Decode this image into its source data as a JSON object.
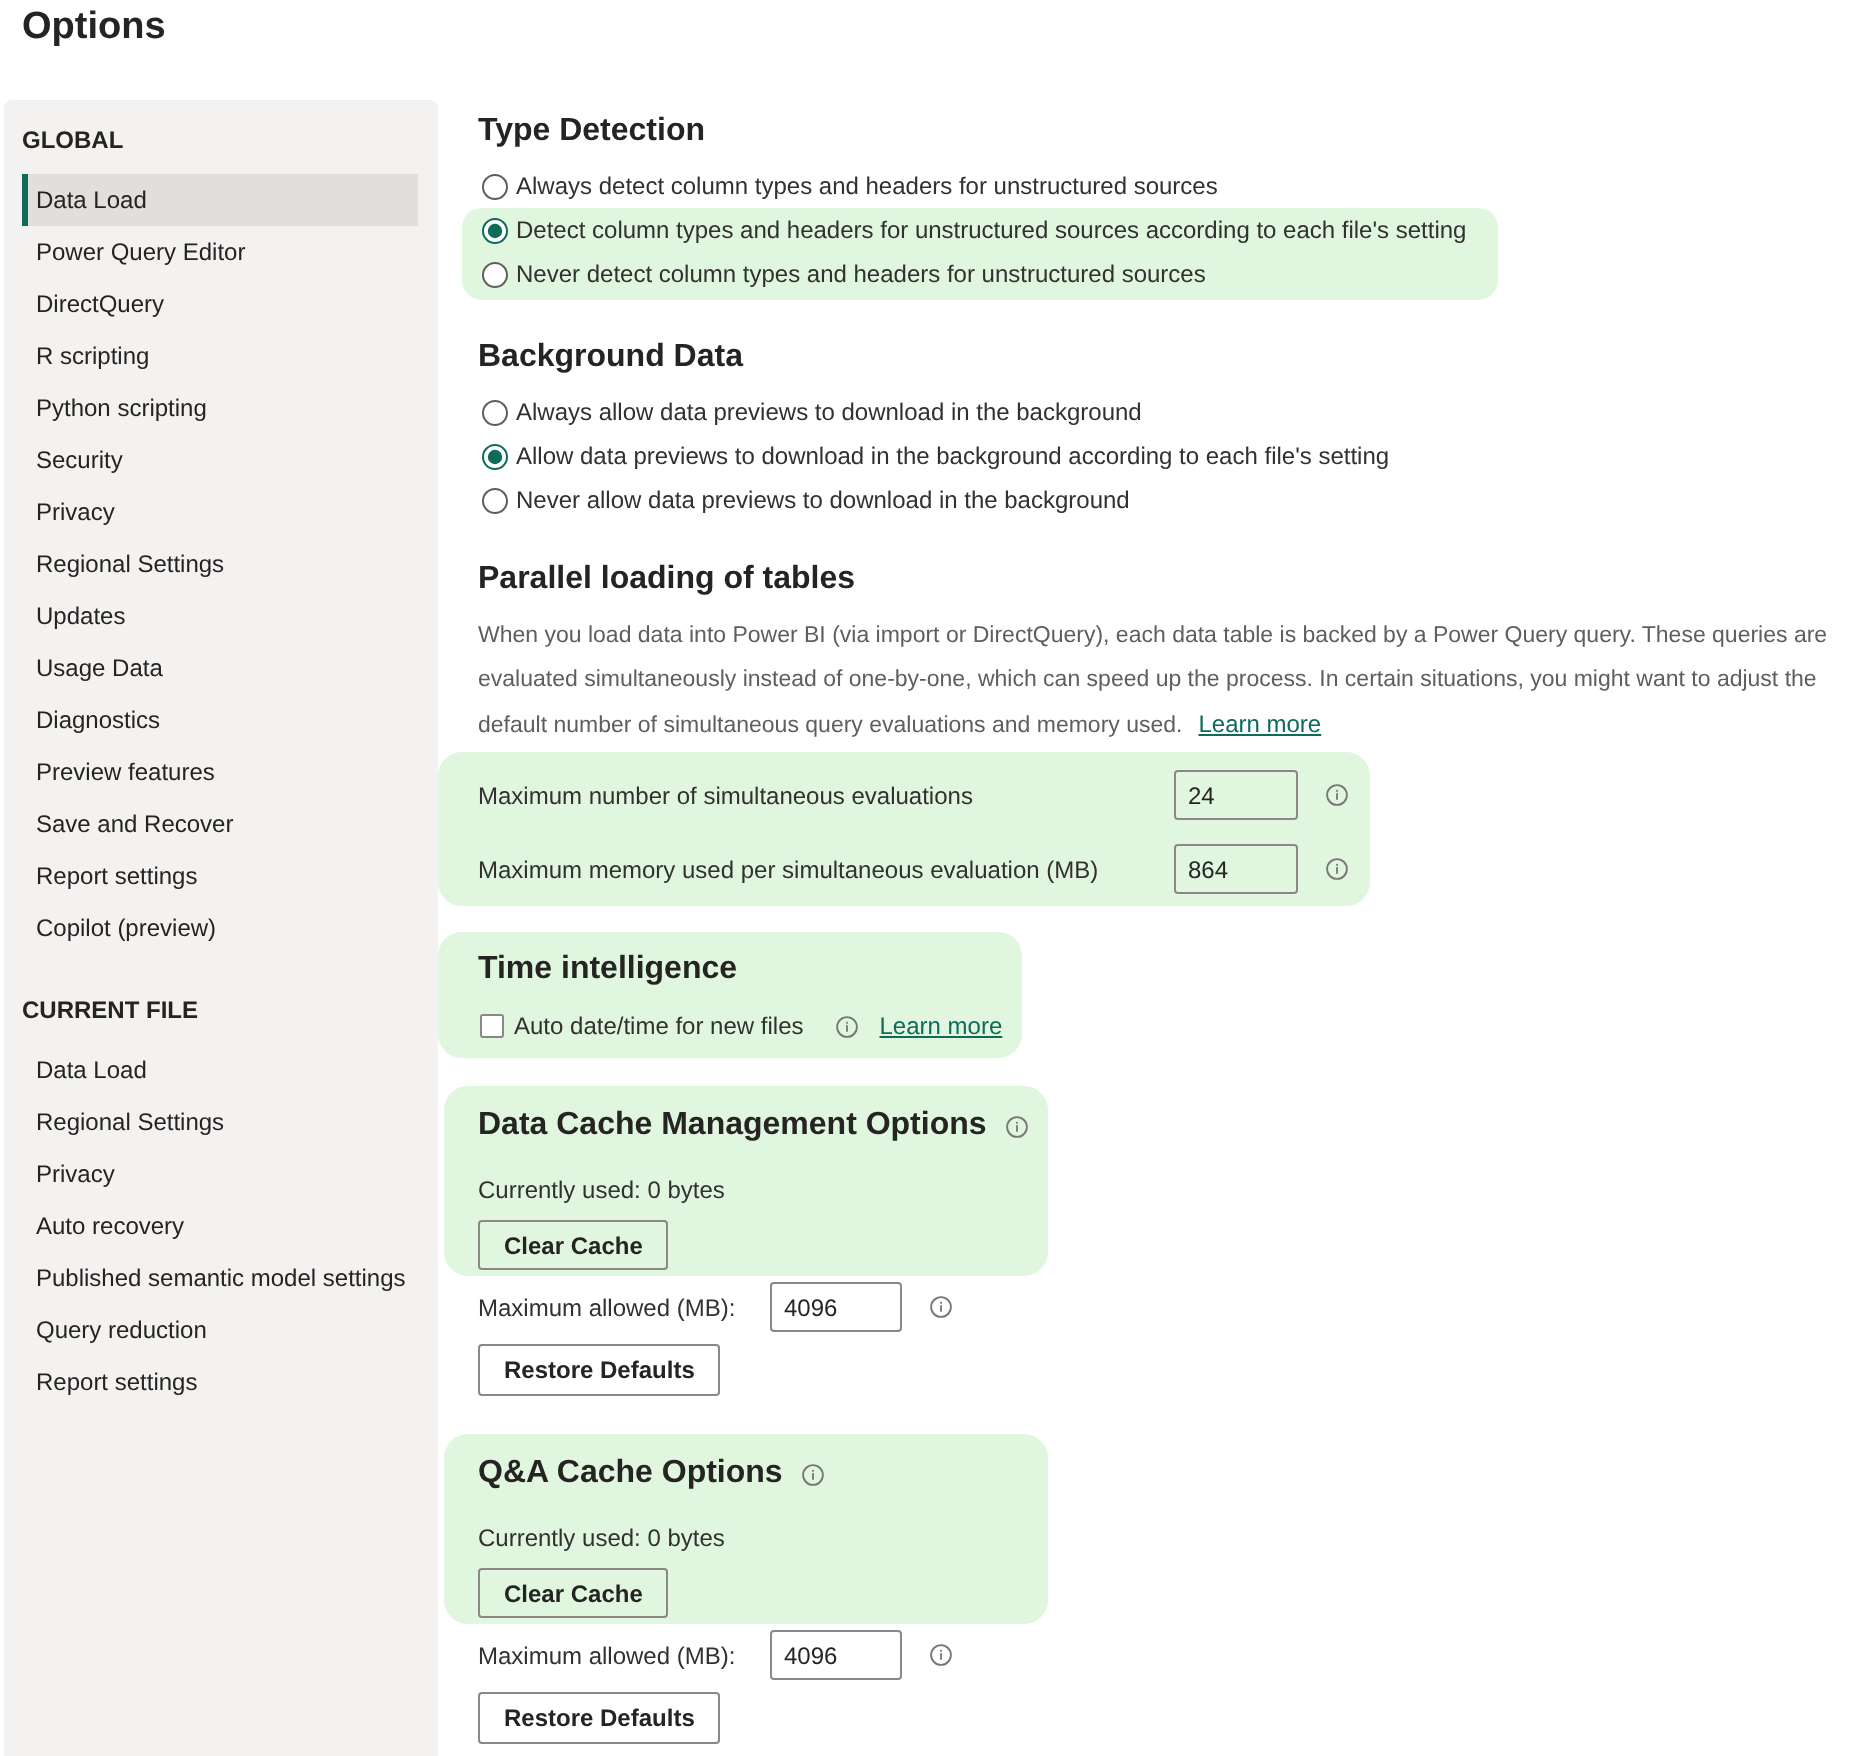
{
  "title": "Options",
  "sidebar": {
    "groups": [
      {
        "heading": "GLOBAL",
        "items": [
          {
            "label": "Data Load",
            "selected": true
          },
          {
            "label": "Power Query Editor",
            "selected": false
          },
          {
            "label": "DirectQuery",
            "selected": false
          },
          {
            "label": "R scripting",
            "selected": false
          },
          {
            "label": "Python scripting",
            "selected": false
          },
          {
            "label": "Security",
            "selected": false
          },
          {
            "label": "Privacy",
            "selected": false
          },
          {
            "label": "Regional Settings",
            "selected": false
          },
          {
            "label": "Updates",
            "selected": false
          },
          {
            "label": "Usage Data",
            "selected": false
          },
          {
            "label": "Diagnostics",
            "selected": false
          },
          {
            "label": "Preview features",
            "selected": false
          },
          {
            "label": "Save and Recover",
            "selected": false
          },
          {
            "label": "Report settings",
            "selected": false
          },
          {
            "label": "Copilot (preview)",
            "selected": false
          }
        ]
      },
      {
        "heading": "CURRENT FILE",
        "items": [
          {
            "label": "Data Load",
            "selected": false
          },
          {
            "label": "Regional Settings",
            "selected": false
          },
          {
            "label": "Privacy",
            "selected": false
          },
          {
            "label": "Auto recovery",
            "selected": false
          },
          {
            "label": "Published semantic model settings",
            "selected": false
          },
          {
            "label": "Query reduction",
            "selected": false
          },
          {
            "label": "Report settings",
            "selected": false
          }
        ]
      }
    ]
  },
  "sections": [
    {
      "kind": "radios",
      "heading": "Type Detection",
      "options": [
        {
          "label": "Always detect column types and headers for unstructured sources",
          "selected": false,
          "highlighted": false
        },
        {
          "label": "Detect column types and headers for unstructured sources according to each file's setting",
          "selected": true,
          "highlighted": true
        },
        {
          "label": "Never detect column types and headers for unstructured sources",
          "selected": false,
          "highlighted": true
        }
      ]
    },
    {
      "kind": "radios",
      "heading": "Background Data",
      "options": [
        {
          "label": "Always allow data previews to download in the background",
          "selected": false,
          "highlighted": false
        },
        {
          "label": "Allow data previews to download in the background according to each file's setting",
          "selected": true,
          "highlighted": false
        },
        {
          "label": "Never allow data previews to download in the background",
          "selected": false,
          "highlighted": false
        }
      ]
    },
    {
      "kind": "limits",
      "heading": "Parallel loading of tables",
      "description": "When you load data into Power BI (via import or DirectQuery), each data table is backed by a Power Query query. These queries are evaluated simultaneously instead of one-by-one, which can speed up the process. In certain situations, you might want to adjust the default number of simultaneous query evaluations and memory used.",
      "link": "Learn more",
      "highlighted": true,
      "fields": [
        {
          "label": "Maximum number of simultaneous evaluations",
          "value": "24"
        },
        {
          "label": "Maximum memory used per simultaneous evaluation (MB)",
          "value": "864"
        }
      ]
    },
    {
      "kind": "checkbox",
      "heading": "Time intelligence",
      "highlighted": true,
      "checkbox": {
        "label": "Auto date/time for new files",
        "checked": false
      },
      "link": "Learn more"
    },
    {
      "kind": "cache",
      "heading": "Data Cache Management Options",
      "highlighted": true,
      "usage": "Currently used: 0 bytes",
      "clear_button": "Clear Cache",
      "limit_label": "Maximum allowed (MB):",
      "limit_value": "4096",
      "restore_button": "Restore Defaults"
    },
    {
      "kind": "cache",
      "heading": "Q&A Cache Options",
      "highlighted": true,
      "usage": "Currently used: 0 bytes",
      "clear_button": "Clear Cache",
      "limit_label": "Maximum allowed (MB):",
      "limit_value": "4096",
      "restore_button": "Restore Defaults"
    }
  ]
}
